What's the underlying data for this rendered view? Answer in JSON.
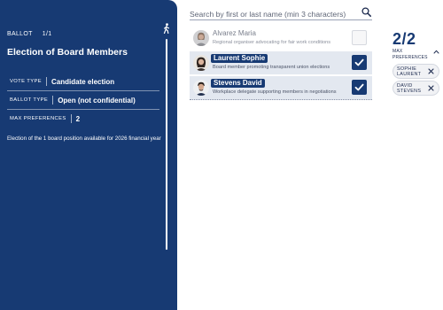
{
  "ballot": {
    "label": "BALLOT",
    "index": "1/1",
    "title": "Election of Board Members",
    "meta": [
      {
        "key": "VOTE TYPE",
        "value": "Candidate election"
      },
      {
        "key": "BALLOT TYPE",
        "value": "Open (not confidential)"
      },
      {
        "key": "MAX PREFERENCES",
        "value": "2"
      }
    ],
    "description": "Election of the 1 board position available for 2026 financial year"
  },
  "search": {
    "placeholder": "Search by first or last name (min 3 characters)",
    "value": ""
  },
  "candidates": [
    {
      "name": "Alvarez Maria",
      "description": "Regional organiser advocating for fair work conditions",
      "selected": false
    },
    {
      "name": "Laurent Sophie",
      "description": "Board member promoting transparent union elections",
      "selected": true
    },
    {
      "name": "Stevens David",
      "description": "Workplace delegate supporting members in negotiations",
      "selected": true
    }
  ],
  "preferences": {
    "count": "2/2",
    "label_line1": "MAX",
    "label_line2": "PREFERENCES",
    "chips": [
      {
        "line1": "SOPHIE",
        "line2": "LAURENT"
      },
      {
        "line1": "DAVID",
        "line2": "STEVENS"
      }
    ]
  },
  "colors": {
    "primary": "#173a73",
    "selected_row": "#e3e8f0"
  },
  "icons": [
    "walking-person-icon",
    "search-icon",
    "checkmark-icon",
    "chevron-up-icon",
    "close-icon"
  ]
}
